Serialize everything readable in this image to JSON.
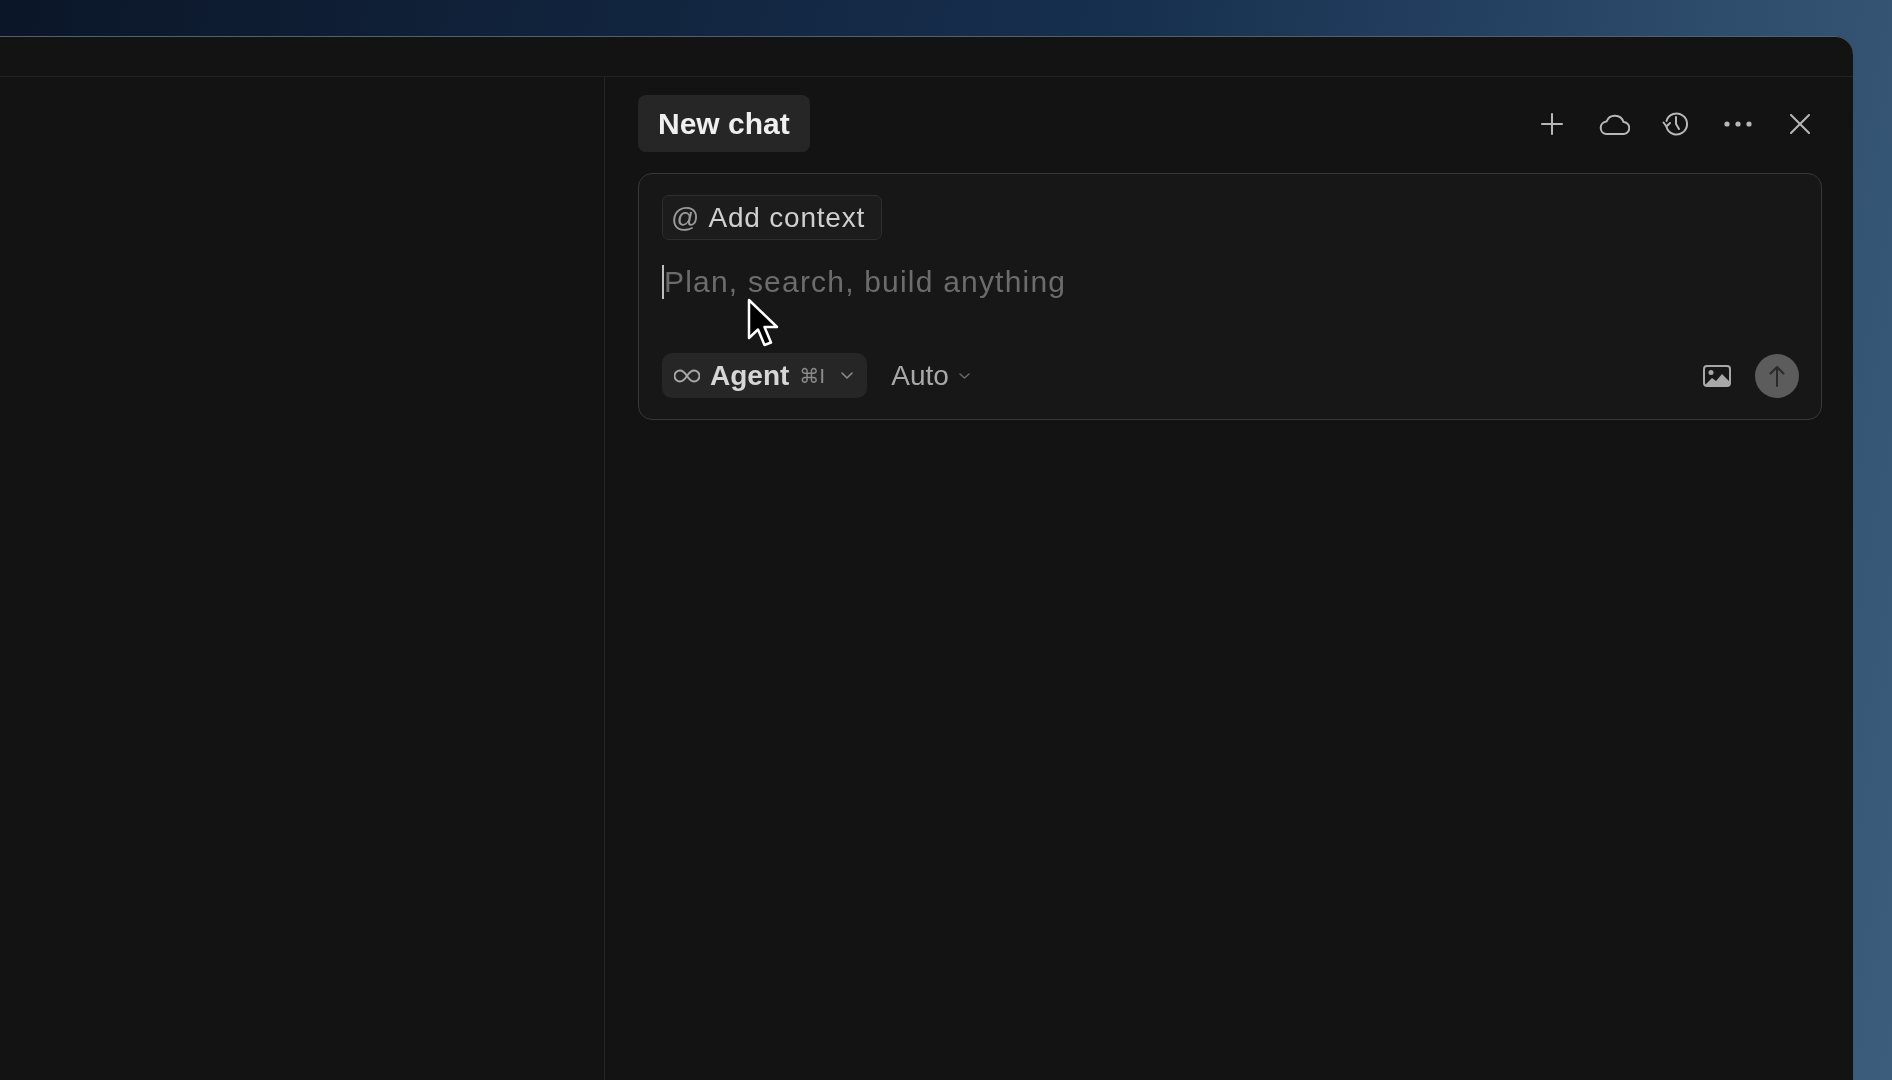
{
  "chat_panel": {
    "tabs": [
      {
        "label": "New chat",
        "selected": true
      }
    ],
    "composer": {
      "context_button": {
        "icon": "@",
        "label": "Add context"
      },
      "placeholder": "Plan, search, build anything",
      "mode_dropdown": {
        "label": "Agent",
        "shortcut": "⌘I"
      },
      "model_dropdown": {
        "label": "Auto"
      }
    }
  }
}
